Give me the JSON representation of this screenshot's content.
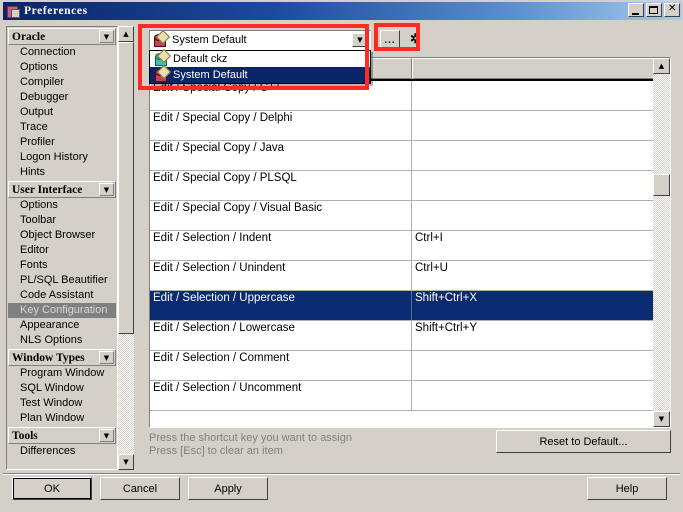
{
  "window": {
    "title": "Preferences",
    "title_icon": "preferences-icon",
    "controls": [
      {
        "name": "minimize",
        "glyph": ""
      },
      {
        "name": "maximize",
        "glyph": ""
      },
      {
        "name": "close",
        "glyph": "✕"
      }
    ]
  },
  "sidebar": {
    "groups": [
      {
        "header": "Oracle",
        "items": [
          "Connection",
          "Options",
          "Compiler",
          "Debugger",
          "Output",
          "Trace",
          "Profiler",
          "Logon History",
          "Hints"
        ]
      },
      {
        "header": "User Interface",
        "items": [
          "Options",
          "Toolbar",
          "Object Browser",
          "Editor",
          "Fonts",
          "PL/SQL Beautifier",
          "Code Assistant",
          "Key Configuration",
          "Appearance",
          "NLS Options"
        ],
        "selected": "Key Configuration"
      },
      {
        "header": "Window Types",
        "items": [
          "Program Window",
          "SQL Window",
          "Test Window",
          "Plan Window"
        ]
      },
      {
        "header": "Tools",
        "items": [
          "Differences"
        ]
      }
    ]
  },
  "toolbar": {
    "combo": {
      "value": "System Default",
      "icon": "keyset-red-icon",
      "arrow_glyph": "▼",
      "options": [
        {
          "label": "Default ckz",
          "icon": "keyset-green-icon",
          "selected": false
        },
        {
          "label": "System Default",
          "icon": "keyset-red-icon",
          "selected": true
        }
      ]
    },
    "ellipsis_button": "...",
    "star_button": "✲"
  },
  "grid": {
    "columns": [
      {
        "label": ""
      },
      {
        "label": ""
      }
    ],
    "rows": [
      {
        "action": "Edit / Special Copy / C++",
        "shortcut": "",
        "selected": false
      },
      {
        "action": "Edit / Special Copy / Delphi",
        "shortcut": "",
        "selected": false
      },
      {
        "action": "Edit / Special Copy / Java",
        "shortcut": "",
        "selected": false
      },
      {
        "action": "Edit / Special Copy / PLSQL",
        "shortcut": "",
        "selected": false
      },
      {
        "action": "Edit / Special Copy / Visual Basic",
        "shortcut": "",
        "selected": false
      },
      {
        "action": "Edit / Selection / Indent",
        "shortcut": "Ctrl+I",
        "selected": false
      },
      {
        "action": "Edit / Selection / Unindent",
        "shortcut": "Ctrl+U",
        "selected": false
      },
      {
        "action": "Edit / Selection / Uppercase",
        "shortcut": "Shift+Ctrl+X",
        "selected": true
      },
      {
        "action": "Edit / Selection / Lowercase",
        "shortcut": "Shift+Ctrl+Y",
        "selected": false
      },
      {
        "action": "Edit / Selection / Comment",
        "shortcut": "",
        "selected": false
      },
      {
        "action": "Edit / Selection / Uncomment",
        "shortcut": "",
        "selected": false
      }
    ]
  },
  "hint": {
    "line1": "Press the shortcut key you want to assign",
    "line2": "Press [Esc] to clear an item"
  },
  "buttons": {
    "reset_to_default": "Reset to Default...",
    "ok": "OK",
    "cancel": "Cancel",
    "apply": "Apply",
    "help": "Help"
  },
  "scroll": {
    "up_glyph": "▲",
    "down_glyph": "▼"
  },
  "annotations": {
    "color": "#fe2b22",
    "boxes": [
      {
        "name": "combo-highlight"
      },
      {
        "name": "buttons-highlight"
      }
    ]
  },
  "colors": {
    "window_bg": "#d4d0c8",
    "titlebar_start": "#0a246a",
    "titlebar_end": "#a6caf0",
    "selection_blue": "#0a2a72",
    "annotation_red": "#fe2b22",
    "disabled_gray": "#808080"
  }
}
